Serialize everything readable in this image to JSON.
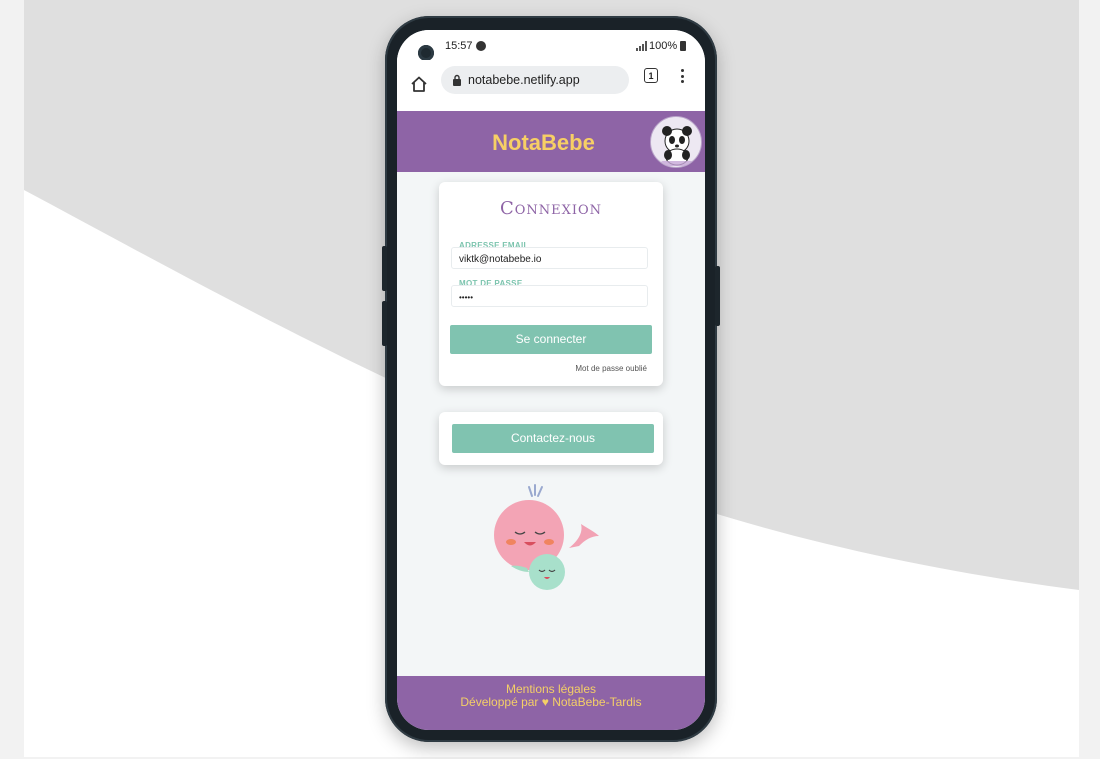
{
  "status_bar": {
    "time": "15:57",
    "battery": "100%"
  },
  "browser": {
    "url": "notabebe.netlify.app",
    "tab_count": "1"
  },
  "app": {
    "brand": "NotaBebe"
  },
  "login": {
    "title": "Connexion",
    "email_label": "ADRESSE EMAIL",
    "email_value": "viktk@notabebe.io",
    "password_label": "MOT DE PASSE",
    "password_value": "•••••",
    "submit_label": "Se connecter",
    "forgot_label": "Mot de passe oublié"
  },
  "contact": {
    "button_label": "Contactez-nous"
  },
  "footer": {
    "legal_label": "Mentions légales",
    "credit_label": "Développé par ♥ NotaBebe-Tardis"
  },
  "colors": {
    "header_purple": "#8e64a6",
    "brand_yellow": "#f7cf65",
    "button_green": "#80c3b0",
    "label_green": "#7cc4ae"
  },
  "icons": [
    "camera-icon",
    "spotify-icon",
    "signal-icon",
    "battery-icon",
    "home-icon",
    "lock-icon",
    "tabs-icon",
    "more-menu-icon",
    "panda-logo-icon",
    "whale-illustration"
  ]
}
